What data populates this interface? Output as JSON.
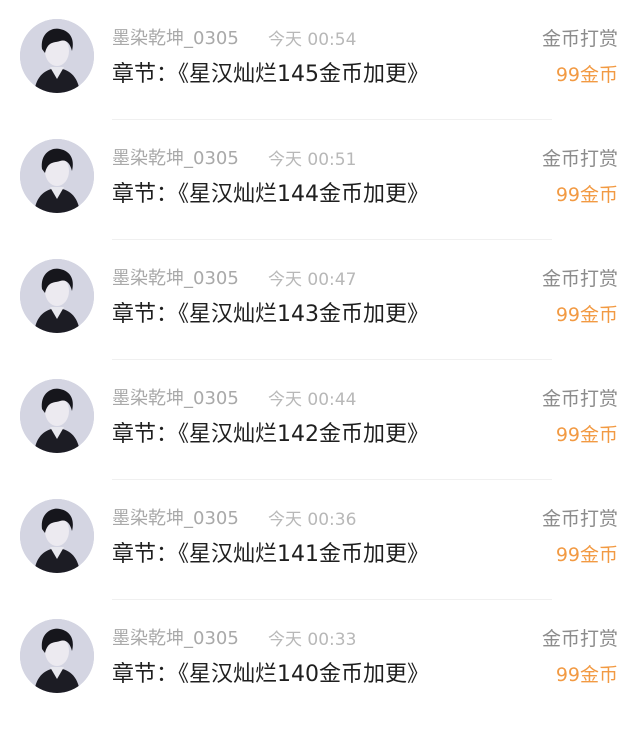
{
  "items": [
    {
      "user": "墨染乾坤_0305",
      "time": "今天 00:54",
      "chapter": "章节：《星汉灿烂145金币加更》",
      "reward_label": "金币打赏",
      "reward_amount": "99金币"
    },
    {
      "user": "墨染乾坤_0305",
      "time": "今天 00:51",
      "chapter": "章节：《星汉灿烂144金币加更》",
      "reward_label": "金币打赏",
      "reward_amount": "99金币"
    },
    {
      "user": "墨染乾坤_0305",
      "time": "今天 00:47",
      "chapter": "章节：《星汉灿烂143金币加更》",
      "reward_label": "金币打赏",
      "reward_amount": "99金币"
    },
    {
      "user": "墨染乾坤_0305",
      "time": "今天 00:44",
      "chapter": "章节：《星汉灿烂142金币加更》",
      "reward_label": "金币打赏",
      "reward_amount": "99金币"
    },
    {
      "user": "墨染乾坤_0305",
      "time": "今天 00:36",
      "chapter": "章节：《星汉灿烂141金币加更》",
      "reward_label": "金币打赏",
      "reward_amount": "99金币"
    },
    {
      "user": "墨染乾坤_0305",
      "time": "今天 00:33",
      "chapter": "章节：《星汉灿烂140金币加更》",
      "reward_label": "金币打赏",
      "reward_amount": "99金币"
    }
  ],
  "colors": {
    "reward_amount": "#f29a43",
    "username": "#a9a9a9",
    "chapter": "#1f1f1f"
  },
  "icons": {
    "avatar": "user-avatar-icon"
  }
}
